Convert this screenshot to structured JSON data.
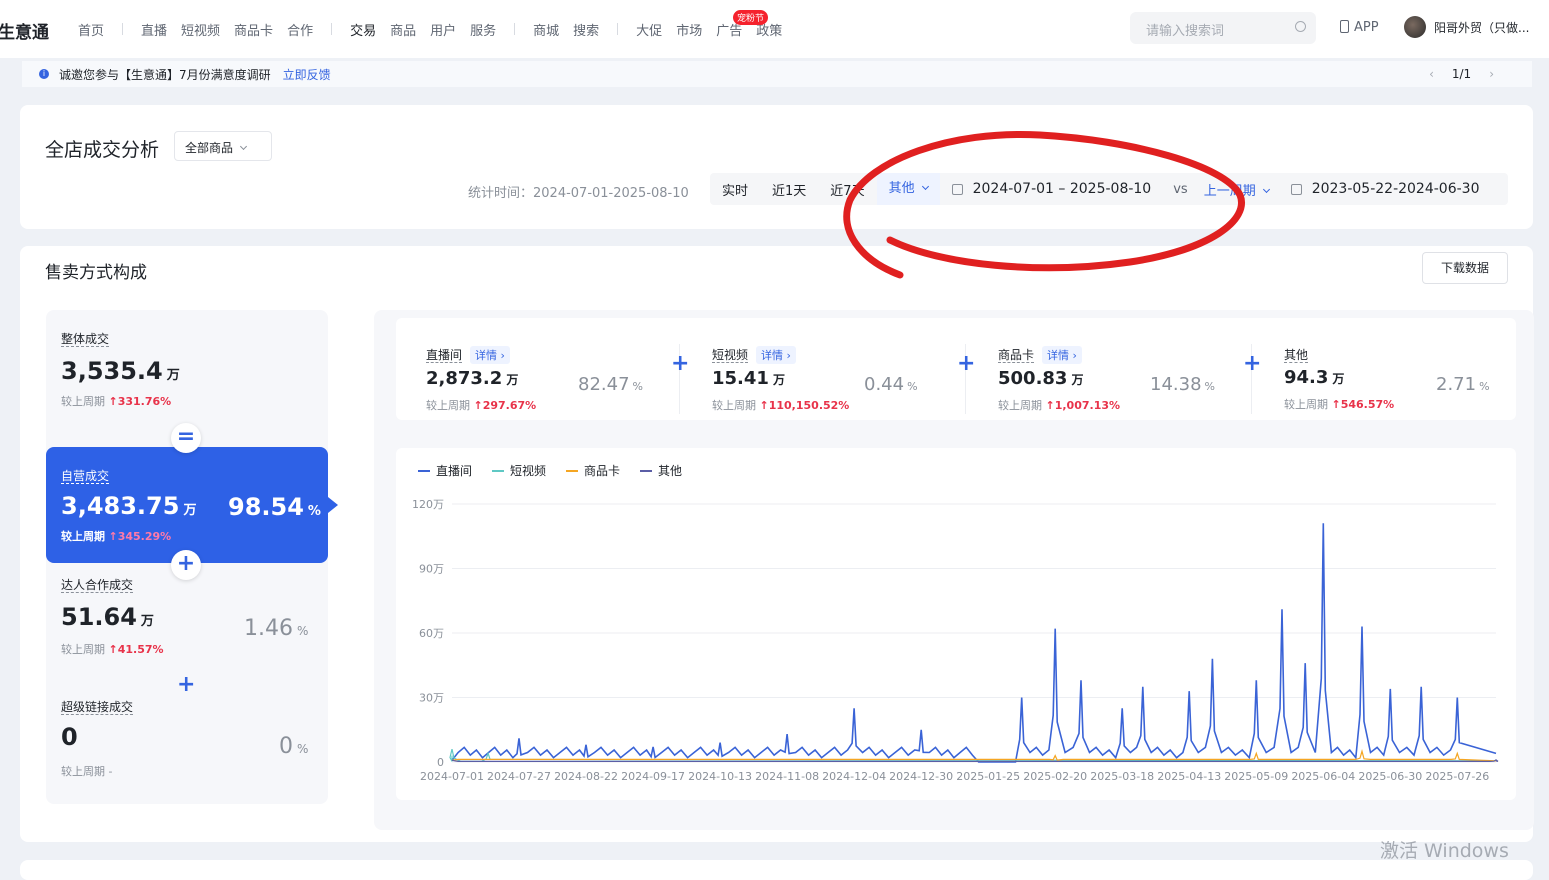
{
  "topnav": {
    "brand": "生意通",
    "items_a": [
      "首页"
    ],
    "items_b": [
      "直播",
      "短视频",
      "商品卡",
      "合作"
    ],
    "items_c": [
      "交易",
      "商品",
      "用户",
      "服务"
    ],
    "items_d": [
      "商城",
      "搜索"
    ],
    "items_e": [
      "大促",
      "市场",
      "广告",
      "政策"
    ],
    "promo_badge": "宠粉节",
    "search_placeholder": "请输入搜索词",
    "app_label": "APP",
    "user_name": "阳哥外贸（只做..."
  },
  "notice": {
    "text": "诚邀您参与【生意通】7月份满意度调研",
    "link": "立即反馈",
    "pager": "1/1"
  },
  "header": {
    "title": "全店成交分析",
    "product_select": "全部商品",
    "stat_time": "统计时间：2024-07-01-2025-08-10",
    "tabs": [
      "实时",
      "近1天",
      "近7天"
    ],
    "active_tab": "其他",
    "date_range": "2024-07-01 – 2025-08-10",
    "vs": "vs",
    "compare_period": "上一周期",
    "compare_range": "2023-05-22-2024-06-30"
  },
  "section": {
    "title": "售卖方式构成",
    "download": "下载数据"
  },
  "left": {
    "total": {
      "label": "整体成交",
      "value": "3,535.4",
      "unit": "万",
      "cmp_label": "较上周期",
      "cmp": "↑331.76%"
    },
    "self": {
      "label": "自营成交",
      "value": "3,483.75",
      "unit": "万",
      "pct": "98.54",
      "pct_unit": "%",
      "cmp_label": "较上周期",
      "cmp": "↑345.29%"
    },
    "creator": {
      "label": "达人合作成交",
      "value": "51.64",
      "unit": "万",
      "pct": "1.46",
      "pct_unit": "%",
      "cmp_label": "较上周期",
      "cmp": "↑41.57%"
    },
    "superlink": {
      "label": "超级链接成交",
      "value": "0",
      "pct": "0",
      "pct_unit": "%",
      "cmp_label": "较上周期 -"
    }
  },
  "kpis": [
    {
      "label": "直播间",
      "detail": "详情 ›",
      "value": "2,873.2",
      "unit": "万",
      "pct": "82.47",
      "pct_unit": "%",
      "cmp_label": "较上周期",
      "cmp": "↑297.67%"
    },
    {
      "label": "短视频",
      "detail": "详情 ›",
      "value": "15.41",
      "unit": "万",
      "pct": "0.44",
      "pct_unit": "%",
      "cmp_label": "较上周期",
      "cmp": "↑110,150.52%"
    },
    {
      "label": "商品卡",
      "detail": "详情 ›",
      "value": "500.83",
      "unit": "万",
      "pct": "14.38",
      "pct_unit": "%",
      "cmp_label": "较上周期",
      "cmp": "↑1,007.13%"
    },
    {
      "label": "其他",
      "detail": "",
      "value": "94.3",
      "unit": "万",
      "pct": "2.71",
      "pct_unit": "%",
      "cmp_label": "较上周期",
      "cmp": "↑546.57%"
    }
  ],
  "chart_data": {
    "type": "line",
    "y_ticks": [
      "0",
      "30万",
      "60万",
      "90万",
      "120万"
    ],
    "ylim": [
      0,
      1200000
    ],
    "x_ticks": [
      "2024-07-01",
      "2024-07-27",
      "2024-08-22",
      "2024-09-17",
      "2024-10-13",
      "2024-11-08",
      "2024-12-04",
      "2024-12-30",
      "2025-01-25",
      "2025-02-20",
      "2025-03-18",
      "2025-04-13",
      "2025-05-09",
      "2025-06-04",
      "2025-06-30",
      "2025-07-26"
    ],
    "colors": {
      "直播间": "#3a63d6",
      "短视频": "#5fc8c4",
      "商品卡": "#f5a623",
      "其他": "#5b5ea6"
    },
    "series": [
      {
        "name": "直播间",
        "peaks": [
          [
            "2024-07-27",
            110000
          ],
          [
            "2024-08-22",
            80000
          ],
          [
            "2024-09-17",
            70000
          ],
          [
            "2024-10-13",
            90000
          ],
          [
            "2024-11-08",
            130000
          ],
          [
            "2024-12-04",
            250000
          ],
          [
            "2024-12-30",
            150000
          ],
          [
            "2025-02-07",
            300000
          ],
          [
            "2025-02-20",
            620000
          ],
          [
            "2025-03-02",
            380000
          ],
          [
            "2025-03-18",
            250000
          ],
          [
            "2025-03-26",
            350000
          ],
          [
            "2025-04-13",
            330000
          ],
          [
            "2025-04-22",
            480000
          ],
          [
            "2025-05-09",
            380000
          ],
          [
            "2025-05-19",
            710000
          ],
          [
            "2025-05-28",
            460000
          ],
          [
            "2025-06-04",
            1110000
          ],
          [
            "2025-06-19",
            630000
          ],
          [
            "2025-06-30",
            340000
          ],
          [
            "2025-07-12",
            350000
          ],
          [
            "2025-07-26",
            300000
          ]
        ]
      },
      {
        "name": "短视频",
        "peaks": [
          [
            "2024-07-01",
            60000
          ],
          [
            "2024-07-15",
            40000
          ]
        ]
      },
      {
        "name": "商品卡",
        "peaks": [
          [
            "2025-02-20",
            30000
          ],
          [
            "2025-05-09",
            40000
          ],
          [
            "2025-06-19",
            50000
          ],
          [
            "2025-07-26",
            40000
          ]
        ]
      },
      {
        "name": "其他",
        "peaks": [
          [
            "2025-08-10",
            10000
          ]
        ]
      }
    ]
  },
  "watermark": "激活 Windows"
}
